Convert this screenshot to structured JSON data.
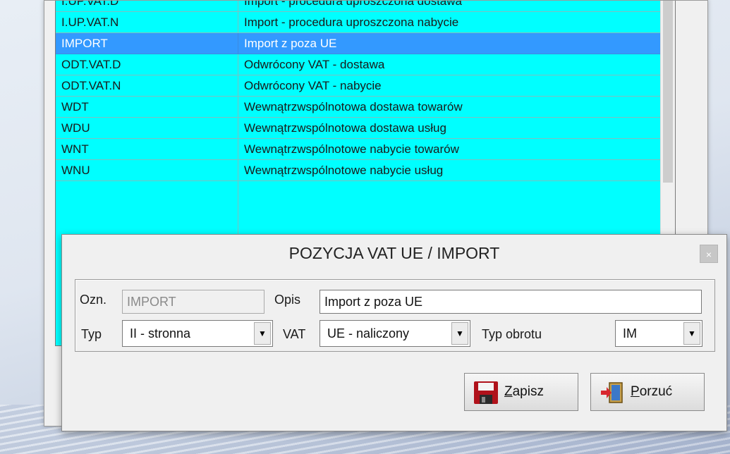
{
  "list": {
    "partial_top": {
      "code": "I.UP.VAT.D",
      "desc": "Import - procedura uproszczona dostawa"
    },
    "rows": [
      {
        "code": "I.UP.VAT.N",
        "desc": "Import - procedura uproszczona nabycie"
      },
      {
        "code": "IMPORT",
        "desc": "Import z poza UE"
      },
      {
        "code": "ODT.VAT.D",
        "desc": "Odwrócony VAT - dostawa"
      },
      {
        "code": "ODT.VAT.N",
        "desc": "Odwrócony VAT - nabycie"
      },
      {
        "code": "WDT",
        "desc": "Wewnątrzwspólnotowa dostawa towarów"
      },
      {
        "code": "WDU",
        "desc": "Wewnątrzwspólnotowa dostawa usług"
      },
      {
        "code": "WNT",
        "desc": "Wewnątrzwspólnotowe nabycie towarów"
      },
      {
        "code": "WNU",
        "desc": "Wewnątrzwspólnotowe nabycie usług"
      }
    ]
  },
  "dialog": {
    "title": "POZYCJA VAT UE / IMPORT",
    "close_glyph": "×",
    "ozn_label": "Ozn.",
    "ozn_value": "IMPORT",
    "opis_label": "Opis",
    "opis_value": "Import z poza UE",
    "typ_label": "Typ",
    "typ_value": "II - stronna",
    "vat_label": "VAT",
    "vat_value": "UE - naliczony",
    "typ_obrotu_label": "Typ obrotu",
    "typ_obrotu_value": "IM",
    "save_mnemonic": "Z",
    "save_rest": "apisz",
    "cancel_mnemonic": "P",
    "cancel_rest": "orzuć",
    "dropdown_glyph": "▼"
  },
  "colors": {
    "row_bg": "#00ffff",
    "row_selected_bg": "#3399ff"
  },
  "icons": {
    "save": "floppy-disk-icon",
    "cancel": "exit-door-icon"
  }
}
